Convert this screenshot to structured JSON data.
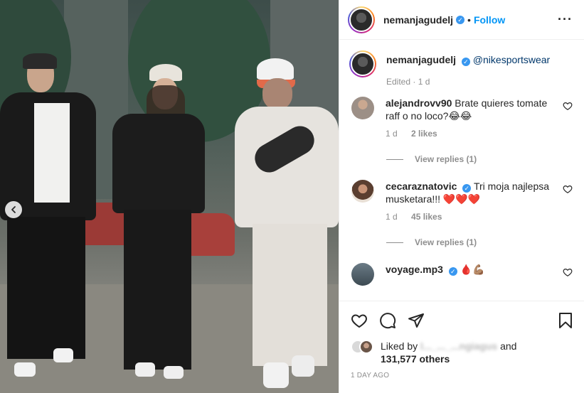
{
  "post": {
    "author": "nemanjagudelj",
    "follow_label": "Follow",
    "separator": "•",
    "more_icon": "more-horizontal-icon",
    "caption_mention": "@nikesportswear",
    "caption_meta": "Edited · 1 d"
  },
  "comments": [
    {
      "username": "alejandrovv90",
      "text": "Brate quieres tomate raff o no loco?😂😂",
      "time": "1 d",
      "likes": "2 likes",
      "view_replies": "View replies (1)"
    },
    {
      "username": "cecaraznatovic",
      "text": "Tri moja najlepsa musketara!!! ❤️❤️❤️",
      "time": "1 d",
      "likes": "45 likes",
      "view_replies": "View replies (1)"
    },
    {
      "username": "voyage.mp3",
      "text": "🩸💪🏽"
    }
  ],
  "likes_summary": {
    "prefix": "Liked by",
    "hidden_name": "l..._..._...ngiagus",
    "and": "and",
    "others": "131,577 others"
  },
  "timestamp": "1 DAY AGO",
  "icons": {
    "like": "heart-icon",
    "comment": "comment-icon",
    "share": "share-icon",
    "save": "bookmark-icon",
    "prev": "chevron-left-icon"
  },
  "colors": {
    "accent": "#0095f6",
    "verified": "#3897f0",
    "meta": "#8e8e8e",
    "mention": "#00376b"
  }
}
